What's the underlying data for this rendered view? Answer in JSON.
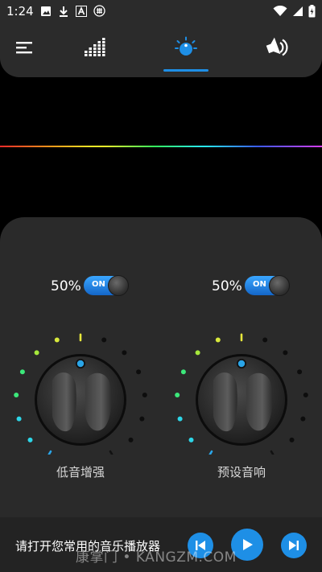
{
  "status_bar": {
    "time": "1:24",
    "icons_left": [
      "image-icon",
      "download-icon",
      "a-icon",
      "grid-circle-icon"
    ],
    "icons_right": [
      "wifi-icon",
      "signal-icon",
      "battery-charging-icon"
    ]
  },
  "tabs": [
    {
      "name": "menu-icon",
      "active": false
    },
    {
      "name": "equalizer-icon",
      "active": false
    },
    {
      "name": "knob-icon",
      "active": true
    },
    {
      "name": "speaker-icon",
      "active": false
    }
  ],
  "colors": {
    "accent": "#1e8fe6",
    "panel": "#2a2a2a",
    "bar": "#2b2b2b"
  },
  "controls": [
    {
      "percent": "50%",
      "toggle_label": "ON",
      "toggle_on": true,
      "label": "低音增强",
      "level": 0.5
    },
    {
      "percent": "50%",
      "toggle_label": "ON",
      "toggle_on": true,
      "label": "预设音响",
      "level": 0.5
    }
  ],
  "bottom": {
    "prompt": "请打开您常用的音乐播放器",
    "buttons": [
      "previous-icon",
      "play-icon",
      "next-icon"
    ]
  },
  "watermark": "康掌门 • KANGZM.COM"
}
